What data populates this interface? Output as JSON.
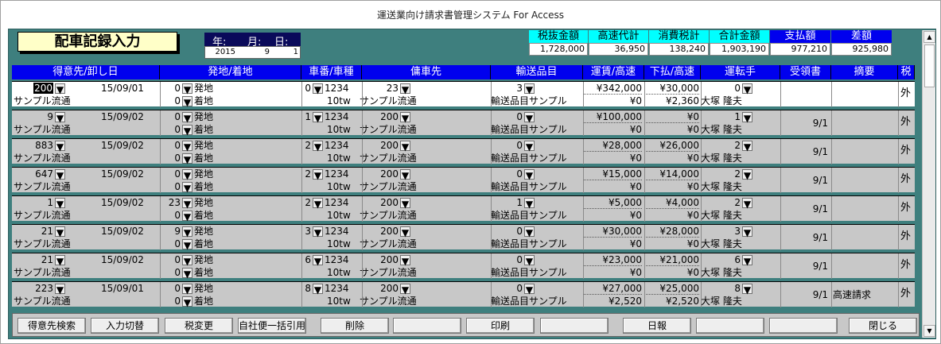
{
  "window": {
    "title": "運送業向け請求書管理システム For Access"
  },
  "form": {
    "title": "配車記録入力"
  },
  "date": {
    "year_label": "年:",
    "month_label": "月:",
    "day_label": "日:",
    "year": "2015",
    "month": "9",
    "day": "1"
  },
  "summary": [
    {
      "label": "税抜金額",
      "value": "1,728,000",
      "style": "cyan"
    },
    {
      "label": "高速代計",
      "value": "36,950",
      "style": "cyan"
    },
    {
      "label": "消費税計",
      "value": "138,240",
      "style": "cyan"
    },
    {
      "label": "合計金額",
      "value": "1,903,190",
      "style": "cyan"
    },
    {
      "label": "支払額",
      "value": "977,210",
      "style": "blue"
    },
    {
      "label": "差額",
      "value": "925,980",
      "style": "blue"
    }
  ],
  "columns": [
    "得意先/卸し日",
    "発地/着地",
    "車番/車種",
    "傭車先",
    "輸送品目",
    "運賃/高速",
    "下払/高速",
    "運転手",
    "受領書",
    "摘要",
    "税"
  ],
  "records": [
    {
      "cust": "200",
      "date": "15/09/01",
      "from_no": "0",
      "from": "発地",
      "to_no": "0",
      "to": "着地",
      "car_no": "0",
      "car": "1234",
      "car_type": "10tw",
      "sub_no": "23",
      "sub": "サンプル流通",
      "item_no": "3",
      "item": "輸送品目サンプル",
      "fare": "¥342,000",
      "fare_hw": "¥0",
      "pay": "¥30,000",
      "pay_hw": "¥2,360",
      "drv_no": "0",
      "drv": "大塚 隆夫",
      "receipt": "",
      "memo": "",
      "tax": "外",
      "name": "サンプル流通",
      "selected": true
    },
    {
      "cust": "9",
      "date": "15/09/02",
      "from_no": "0",
      "from": "発地",
      "to_no": "0",
      "to": "着地",
      "car_no": "1",
      "car": "1234",
      "car_type": "10tw",
      "sub_no": "200",
      "sub": "サンプル流通",
      "item_no": "0",
      "item": "輸送品目サンプル",
      "fare": "¥100,000",
      "fare_hw": "¥0",
      "pay": "¥0",
      "pay_hw": "¥0",
      "drv_no": "1",
      "drv": "大塚 隆夫",
      "receipt": "9/1",
      "memo": "",
      "tax": "外",
      "name": "サンプル流通",
      "selected": false
    },
    {
      "cust": "883",
      "date": "15/09/02",
      "from_no": "0",
      "from": "発地",
      "to_no": "0",
      "to": "着地",
      "car_no": "2",
      "car": "1234",
      "car_type": "10tw",
      "sub_no": "200",
      "sub": "サンプル流通",
      "item_no": "0",
      "item": "輸送品目サンプル",
      "fare": "¥28,000",
      "fare_hw": "¥0",
      "pay": "¥26,000",
      "pay_hw": "¥0",
      "drv_no": "2",
      "drv": "大塚 隆夫",
      "receipt": "9/1",
      "memo": "",
      "tax": "外",
      "name": "サンプル流通",
      "selected": false
    },
    {
      "cust": "647",
      "date": "15/09/02",
      "from_no": "0",
      "from": "発地",
      "to_no": "0",
      "to": "着地",
      "car_no": "2",
      "car": "1234",
      "car_type": "10tw",
      "sub_no": "200",
      "sub": "サンプル流通",
      "item_no": "0",
      "item": "輸送品目サンプル",
      "fare": "¥15,000",
      "fare_hw": "¥0",
      "pay": "¥14,000",
      "pay_hw": "¥0",
      "drv_no": "2",
      "drv": "大塚 隆夫",
      "receipt": "9/1",
      "memo": "",
      "tax": "外",
      "name": "サンプル流通",
      "selected": false
    },
    {
      "cust": "1",
      "date": "15/09/02",
      "from_no": "23",
      "from": "発地",
      "to_no": "0",
      "to": "着地",
      "car_no": "2",
      "car": "1234",
      "car_type": "10tw",
      "sub_no": "200",
      "sub": "サンプル流通",
      "item_no": "1",
      "item": "輸送品目サンプル",
      "fare": "¥5,000",
      "fare_hw": "¥0",
      "pay": "¥4,000",
      "pay_hw": "¥0",
      "drv_no": "2",
      "drv": "大塚 隆夫",
      "receipt": "9/1",
      "memo": "",
      "tax": "外",
      "name": "サンプル流通",
      "selected": false
    },
    {
      "cust": "21",
      "date": "15/09/02",
      "from_no": "9",
      "from": "発地",
      "to_no": "0",
      "to": "着地",
      "car_no": "3",
      "car": "1234",
      "car_type": "10tw",
      "sub_no": "200",
      "sub": "サンプル流通",
      "item_no": "0",
      "item": "輸送品目サンプル",
      "fare": "¥30,000",
      "fare_hw": "¥0",
      "pay": "¥28,000",
      "pay_hw": "¥0",
      "drv_no": "3",
      "drv": "大塚 隆夫",
      "receipt": "9/1",
      "memo": "",
      "tax": "外",
      "name": "サンプル流通",
      "selected": false
    },
    {
      "cust": "21",
      "date": "15/09/02",
      "from_no": "0",
      "from": "発地",
      "to_no": "0",
      "to": "着地",
      "car_no": "6",
      "car": "1234",
      "car_type": "10tw",
      "sub_no": "200",
      "sub": "サンプル流通",
      "item_no": "0",
      "item": "輸送品目サンプル",
      "fare": "¥23,000",
      "fare_hw": "¥0",
      "pay": "¥21,000",
      "pay_hw": "¥0",
      "drv_no": "6",
      "drv": "大塚 隆夫",
      "receipt": "9/1",
      "memo": "",
      "tax": "外",
      "name": "サンプル流通",
      "selected": false
    },
    {
      "cust": "223",
      "date": "15/09/01",
      "from_no": "0",
      "from": "発地",
      "to_no": "0",
      "to": "着地",
      "car_no": "8",
      "car": "1234",
      "car_type": "10tw",
      "sub_no": "200",
      "sub": "サンプル流通",
      "item_no": "0",
      "item": "輸送品目サンプル",
      "fare": "¥27,000",
      "fare_hw": "¥2,520",
      "pay": "¥25,000",
      "pay_hw": "¥2,520",
      "drv_no": "8",
      "drv": "大塚 隆夫",
      "receipt": "9/1",
      "memo": "高速請求",
      "tax": "外",
      "name": "サンプル流通",
      "selected": false
    }
  ],
  "buttons": [
    {
      "label": "得意先検索",
      "name": "customer-search-button"
    },
    {
      "label": "入力切替",
      "name": "input-switch-button"
    },
    {
      "label": "税変更",
      "name": "tax-change-button"
    },
    {
      "label": "自社便一括引用",
      "name": "bulk-quote-button"
    },
    {
      "label": "削除",
      "name": "delete-button"
    },
    {
      "label": "",
      "name": "blank-button-1"
    },
    {
      "label": "印刷",
      "name": "print-button"
    },
    {
      "label": "",
      "name": "blank-button-2"
    },
    {
      "label": "日報",
      "name": "daily-report-button"
    },
    {
      "label": "",
      "name": "blank-button-3"
    },
    {
      "label": "",
      "name": "blank-button-4"
    },
    {
      "label": "閉じる",
      "name": "close-button"
    }
  ],
  "icons": {
    "dropdown": "chevron-down-icon",
    "scroll_up": "scroll-up-icon",
    "scroll_down": "scroll-down-icon"
  }
}
